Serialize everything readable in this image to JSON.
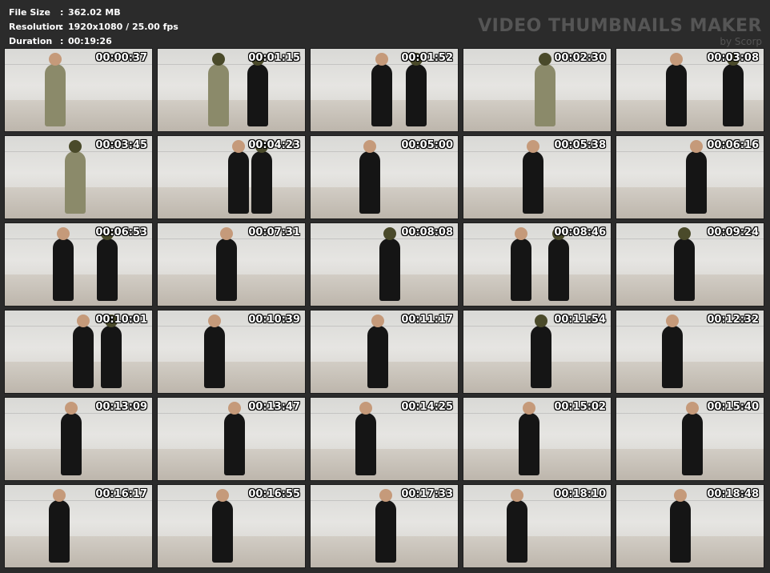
{
  "info": {
    "file_size_label": "File Size",
    "file_size": "362.02 MB",
    "resolution_label": "Resolution",
    "resolution": "1920x1080 / 25.00 fps",
    "duration_label": "Duration",
    "duration": "00:19:26",
    "separator": ":"
  },
  "watermark": {
    "title": "VIDEO THUMBNAILS MAKER",
    "by": "by Scorp"
  },
  "thumbnails": [
    {
      "time": "00:00:37"
    },
    {
      "time": "00:01:15"
    },
    {
      "time": "00:01:52"
    },
    {
      "time": "00:02:30"
    },
    {
      "time": "00:03:08"
    },
    {
      "time": "00:03:45"
    },
    {
      "time": "00:04:23"
    },
    {
      "time": "00:05:00"
    },
    {
      "time": "00:05:38"
    },
    {
      "time": "00:06:16"
    },
    {
      "time": "00:06:53"
    },
    {
      "time": "00:07:31"
    },
    {
      "time": "00:08:08"
    },
    {
      "time": "00:08:46"
    },
    {
      "time": "00:09:24"
    },
    {
      "time": "00:10:01"
    },
    {
      "time": "00:10:39"
    },
    {
      "time": "00:11:17"
    },
    {
      "time": "00:11:54"
    },
    {
      "time": "00:12:32"
    },
    {
      "time": "00:13:09"
    },
    {
      "time": "00:13:47"
    },
    {
      "time": "00:14:25"
    },
    {
      "time": "00:15:02"
    },
    {
      "time": "00:15:40"
    },
    {
      "time": "00:16:17"
    },
    {
      "time": "00:16:55"
    },
    {
      "time": "00:17:33"
    },
    {
      "time": "00:18:10"
    },
    {
      "time": "00:18:48"
    }
  ]
}
